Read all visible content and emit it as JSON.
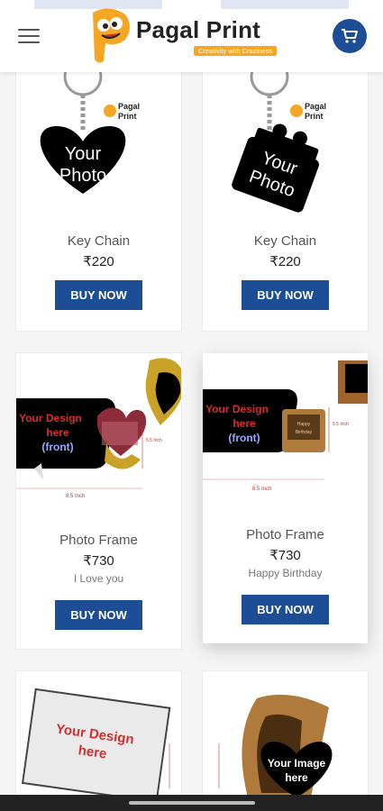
{
  "header": {
    "brand_name": "Pagal Print",
    "tagline": "Creativity with Craziness",
    "colors": {
      "brand_blue": "#1c4d95",
      "brand_orange": "#f5a623"
    }
  },
  "products": [
    {
      "thumb_text": "Your Photo",
      "title": "Key Chain",
      "price": "₹220",
      "subtitle": "",
      "buy_label": "BUY NOW"
    },
    {
      "thumb_text": "Your Photo",
      "title": "Key Chain",
      "price": "₹220",
      "subtitle": "",
      "buy_label": "BUY NOW"
    },
    {
      "thumb_text": "Your Design here (front)",
      "title": "Photo Frame",
      "price": "₹730",
      "subtitle": "I Love you",
      "buy_label": "BUY NOW",
      "dim_label": "8.5 Inch"
    },
    {
      "thumb_text": "Your Design here (front)",
      "title": "Photo Frame",
      "price": "₹730",
      "subtitle": "Happy Birthday",
      "buy_label": "BUY NOW",
      "dim_label": "8.5 Inch"
    },
    {
      "thumb_text": "Your Design here",
      "title": "",
      "price": "",
      "subtitle": "",
      "buy_label": ""
    },
    {
      "thumb_text": "Your Image here",
      "title": "",
      "price": "",
      "subtitle": "",
      "buy_label": ""
    }
  ],
  "thumb_brand": "Pagal Print"
}
